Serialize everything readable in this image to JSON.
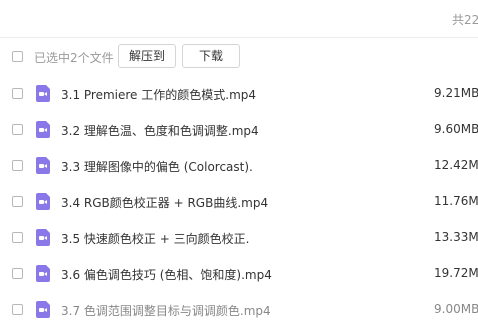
{
  "header": {
    "total_count_text": "共22"
  },
  "toolbar": {
    "selection_text": "已选中2个文件",
    "extract_button_label": "解压到",
    "download_button_label": "下载"
  },
  "files": [
    {
      "name": "3.1 Premiere 工作的颜色模式.mp4",
      "size": "9.21MB"
    },
    {
      "name": "3.2 理解色温、色度和色调调整.mp4",
      "size": "9.60MB"
    },
    {
      "name": "3.3 理解图像中的偏色 (Colorcast).",
      "size": "12.42M"
    },
    {
      "name": "3.4 RGB颜色校正器 + RGB曲线.mp4",
      "size": "11.76M"
    },
    {
      "name": "3.5 快速颜色校正 + 三向颜色校正.",
      "size": "13.33M"
    },
    {
      "name": "3.6 偏色调色技巧 (色相、饱和度).mp4",
      "size": "19.72M"
    },
    {
      "name": "3.7 色调范围调整目标与调调颜色.mp4",
      "size": "9.00MB"
    }
  ]
}
